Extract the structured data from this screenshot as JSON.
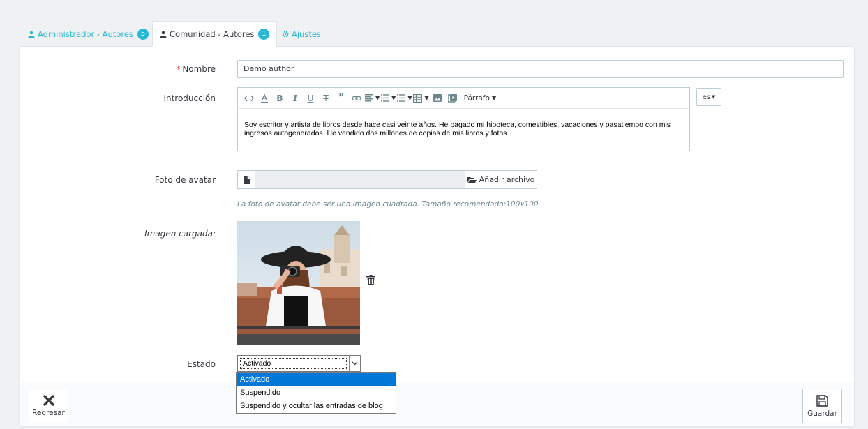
{
  "tabs": [
    {
      "label": "Administrador - Autores",
      "badge": "5",
      "icon": "user-icon"
    },
    {
      "label": "Comunidad - Autores",
      "badge": "1",
      "icon": "user-icon"
    },
    {
      "label": "Ajustes",
      "icon": "gear-icon"
    }
  ],
  "form": {
    "name": {
      "label": "Nombre",
      "required_mark": "*",
      "value": "Demo author"
    },
    "intro": {
      "label": "Introducción",
      "paragraph_label": "Párrafo",
      "lang": "es",
      "text": "Soy escritor y artista de libros desde hace casi veinte años. He pagado mi hipoteca, comestibles, vacaciones y pasatiempo con mis ingresos autogenerados. He vendido dos millones de copias de mis libros y fotos."
    },
    "avatar": {
      "label": "Foto de avatar",
      "add_button": "Añadir archivo",
      "help": "La foto de avatar debe ser una imagen cuadrada. Tamaño recomendado:100x100"
    },
    "uploaded": {
      "label": "Imagen cargada:"
    },
    "status": {
      "label": "Estado",
      "value": "Activado",
      "options": [
        "Activado",
        "Suspendido",
        "Suspendido y ocultar las entradas de blog"
      ]
    }
  },
  "footer": {
    "back": "Regresar",
    "save": "Guardar"
  },
  "colors": {
    "accent": "#25b9d7",
    "required": "#e84e4e",
    "selected_option": "#0078d7"
  }
}
